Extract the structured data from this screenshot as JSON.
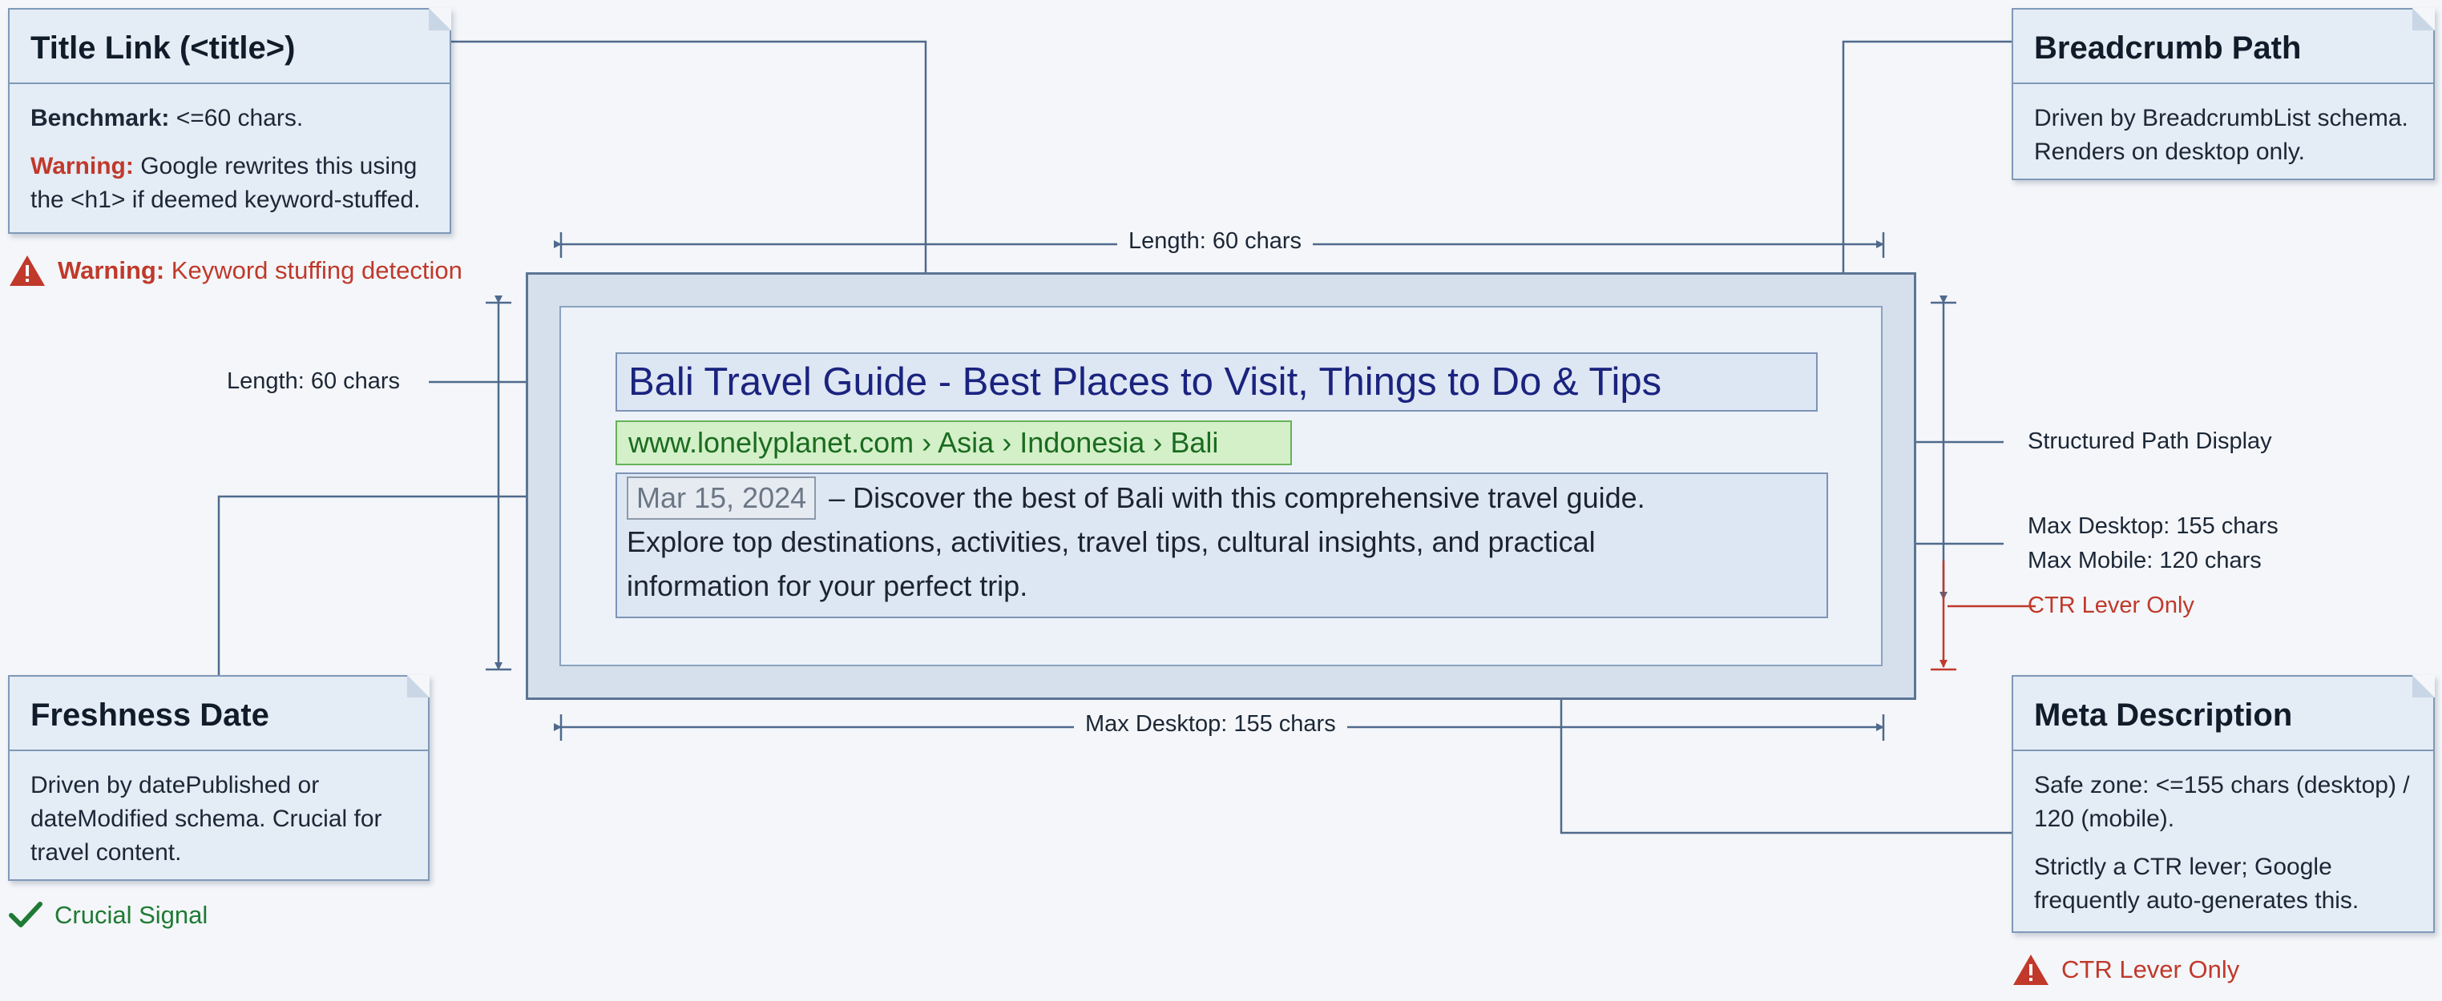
{
  "serp": {
    "title": "Bali Travel Guide - Best Places to Visit, Things to Do & Tips",
    "url": "www.lonelyplanet.com › Asia › Indonesia › Bali",
    "date": "Mar 15, 2024",
    "date_separator": " – ",
    "description_line1": "Discover the best of Bali with this comprehensive travel guide.",
    "description_line2": "Explore top destinations, activities, travel tips, cultural insights, and practical",
    "description_line3": "information for your perfect trip."
  },
  "dimensions": {
    "top_width": "Length: 60 chars",
    "bottom_width": "Max Desktop: 155 chars",
    "title_length": "Length: 60 chars",
    "structured_path": "Structured Path Display",
    "max_desktop": "Max Desktop: 155 chars",
    "max_mobile": "Max Mobile: 120 chars",
    "ctr_lever": "CTR Lever Only"
  },
  "notes": {
    "title_link": {
      "heading": "Title Link (<title>)",
      "benchmark_label": "Benchmark:",
      "benchmark_text": " <=60 chars.",
      "warning_label": "Warning:",
      "warning_text": " Google rewrites this using the <h1> if deemed keyword-stuffed."
    },
    "breadcrumb": {
      "heading": "Breadcrumb Path",
      "body": "Driven by BreadcrumbList schema. Renders on desktop only."
    },
    "freshness": {
      "heading": "Freshness Date",
      "body": "Driven by datePublished or dateModified schema. Crucial for travel content."
    },
    "meta": {
      "heading": "Meta Description",
      "body1": "Safe zone: <=155 chars (desktop) / 120 (mobile).",
      "body2": "Strictly a CTR lever; Google frequently auto-generates this."
    }
  },
  "badges": {
    "keyword_warning_label": "Warning:",
    "keyword_warning_text": " Keyword stuffing detection",
    "crucial_signal": "Crucial Signal",
    "ctr_lever_only": "CTR Lever Only"
  },
  "colors": {
    "warning": "#c0392b",
    "success": "#1f7a34",
    "title_blue": "#1a237e",
    "url_green": "#1b6b1f",
    "ctr_arrow": "#c0392b"
  },
  "icons": {
    "warning": "warning-triangle-icon",
    "check": "check-icon"
  }
}
